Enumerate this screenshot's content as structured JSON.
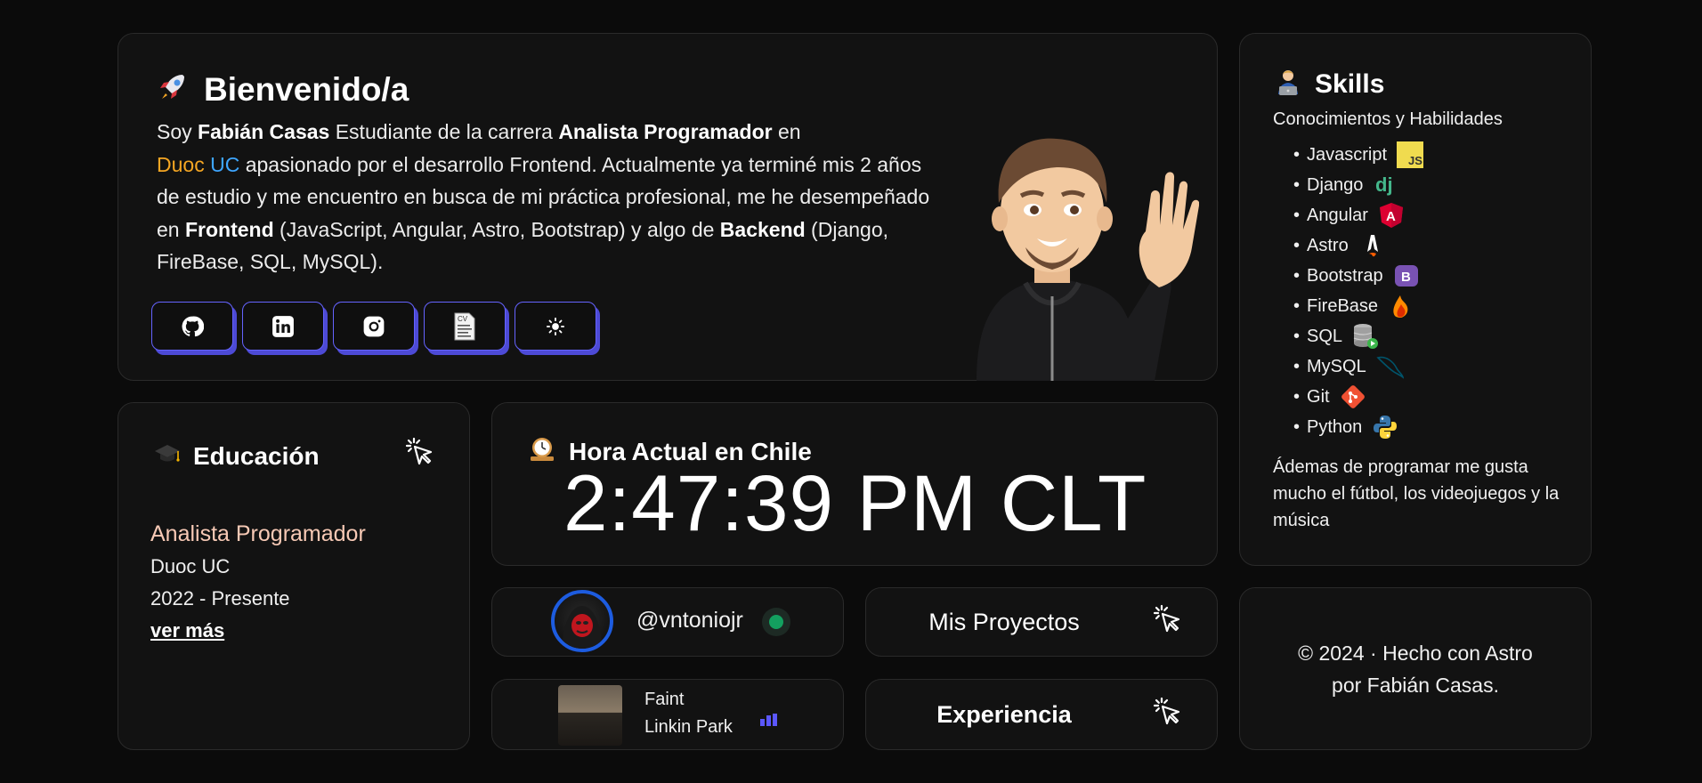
{
  "welcome": {
    "title": "Bienvenido/a",
    "intro_1": "Soy ",
    "name": "Fabián Casas",
    "intro_2": " Estudiante de la carrera ",
    "career": "Analista Programador",
    "intro_3": " en ",
    "duoc": "Duoc",
    "uc": "UC",
    "intro_4": " apasionado por el desarrollo Frontend. Actualmente ya terminé mis 2 años de estudio y me encuentro en busca de mi práctica profesional, me he desempeñado en ",
    "frontend": "Frontend",
    "intro_5": " (JavaScript, Angular, Astro, Bootstrap) y algo de ",
    "backend": "Backend",
    "intro_6": " (Django, FireBase, SQL, MySQL).",
    "social": [
      {
        "icon": "github-icon"
      },
      {
        "icon": "linkedin-icon"
      },
      {
        "icon": "instagram-icon"
      },
      {
        "icon": "cv-icon",
        "label": "CV"
      },
      {
        "icon": "sun-icon"
      }
    ]
  },
  "skills": {
    "title": "Skills",
    "subtitle": "Conocimientos y Habilidades",
    "items": [
      {
        "label": "Javascript",
        "icon": "javascript-icon",
        "badge": "JS"
      },
      {
        "label": "Django",
        "icon": "django-icon",
        "badge": "dj"
      },
      {
        "label": "Angular",
        "icon": "angular-icon",
        "badge": "A"
      },
      {
        "label": "Astro",
        "icon": "astro-icon"
      },
      {
        "label": "Bootstrap",
        "icon": "bootstrap-icon",
        "badge": "B"
      },
      {
        "label": "FireBase",
        "icon": "firebase-icon"
      },
      {
        "label": "SQL",
        "icon": "sql-icon"
      },
      {
        "label": "MySQL",
        "icon": "mysql-icon"
      },
      {
        "label": "Git",
        "icon": "git-icon"
      },
      {
        "label": "Python",
        "icon": "python-icon"
      }
    ],
    "extra": "Ádemas de programar me gusta mucho el fútbol, los videojuegos y la música"
  },
  "education": {
    "title": "Educación",
    "degree": "Analista Programador",
    "school": "Duoc UC",
    "years": "2022 - Presente",
    "more": "ver más"
  },
  "clock": {
    "title": "Hora Actual en Chile",
    "time": "2:47:39 PM CLT"
  },
  "profile": {
    "handle": "@vntoniojr"
  },
  "projects": {
    "label": "Mis Proyectos"
  },
  "music": {
    "song": "Faint",
    "artist": "Linkin Park"
  },
  "experience": {
    "label": "Experiencia"
  },
  "footer": {
    "line1": "© 2024 · Hecho con Astro",
    "line2": "por Fabián Casas."
  },
  "colors": {
    "accent": "#6563ff",
    "background": "#0b0b0b",
    "card": "#121212",
    "duoc": "#f5a623",
    "uc": "#3ea6ff",
    "status": "#13a05f"
  }
}
